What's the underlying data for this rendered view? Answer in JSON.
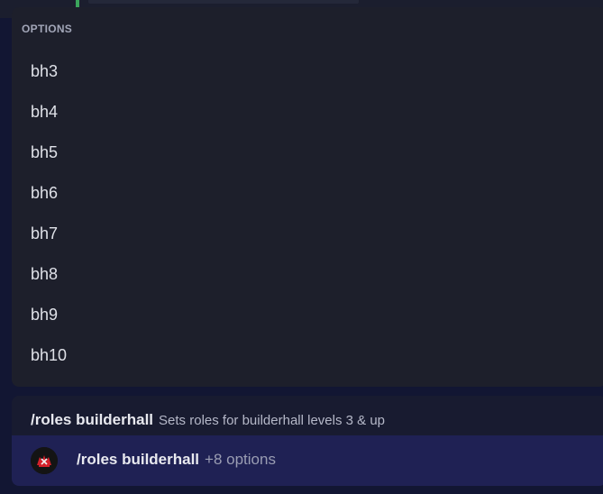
{
  "options": {
    "header": "OPTIONS",
    "items": [
      {
        "label": "bh3"
      },
      {
        "label": "bh4"
      },
      {
        "label": "bh5"
      },
      {
        "label": "bh6"
      },
      {
        "label": "bh7"
      },
      {
        "label": "bh8"
      },
      {
        "label": "bh9"
      },
      {
        "label": "bh10"
      }
    ]
  },
  "command": {
    "name": "/roles builderhall",
    "description": "Sets roles for builderhall levels 3 & up",
    "extra_options": "+8 options",
    "avatar_icon": "bot-avatar-icon"
  },
  "colors": {
    "background": "#121633",
    "panel": "#1d1f2b",
    "selected_row": "#1f2154",
    "accent_green": "#3ba55c"
  }
}
